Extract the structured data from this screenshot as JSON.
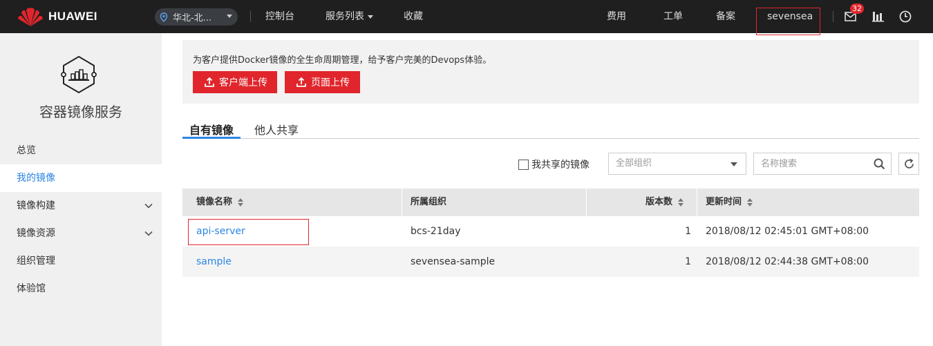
{
  "header": {
    "brand": "HUAWEI",
    "region": "华北-北...",
    "nav": [
      "控制台",
      "服务列表",
      "收藏"
    ],
    "right_nav": [
      "费用",
      "工单",
      "备案"
    ],
    "username": "sevensea",
    "message_count": "32",
    "icons": [
      "mail-icon",
      "bar-chart-icon",
      "clock-icon"
    ]
  },
  "sidebar": {
    "service_name": "容器镜像服务",
    "items": [
      {
        "label": "总览",
        "expandable": false,
        "active": false
      },
      {
        "label": "我的镜像",
        "expandable": false,
        "active": true
      },
      {
        "label": "镜像构建",
        "expandable": true,
        "active": false
      },
      {
        "label": "镜像资源",
        "expandable": true,
        "active": false
      },
      {
        "label": "组织管理",
        "expandable": false,
        "active": false
      },
      {
        "label": "体验馆",
        "expandable": false,
        "active": false
      }
    ]
  },
  "banner": {
    "text": "为客户提供Docker镜像的全生命周期管理，给予客户完美的Devops体验。",
    "client_upload": "客户端上传",
    "page_upload": "页面上传"
  },
  "tabs": {
    "own": "自有镜像",
    "shared": "他人共享"
  },
  "filters": {
    "shared_checkbox": "我共享的镜像",
    "org_select": "全部组织",
    "search_placeholder": "名称搜索"
  },
  "table": {
    "headers": {
      "name": "镜像名称",
      "org": "所属组织",
      "versions": "版本数",
      "updated": "更新时间"
    },
    "rows": [
      {
        "name": "api-server",
        "org": "bcs-21day",
        "versions": "1",
        "updated": "2018/08/12 02:45:01 GMT+08:00"
      },
      {
        "name": "sample",
        "org": "sevensea-sample",
        "versions": "1",
        "updated": "2018/08/12 02:44:38 GMT+08:00"
      }
    ]
  },
  "colors": {
    "brand_red": "#e0262c",
    "link_blue": "#2b85e4",
    "topbar": "#1f1f1f"
  }
}
